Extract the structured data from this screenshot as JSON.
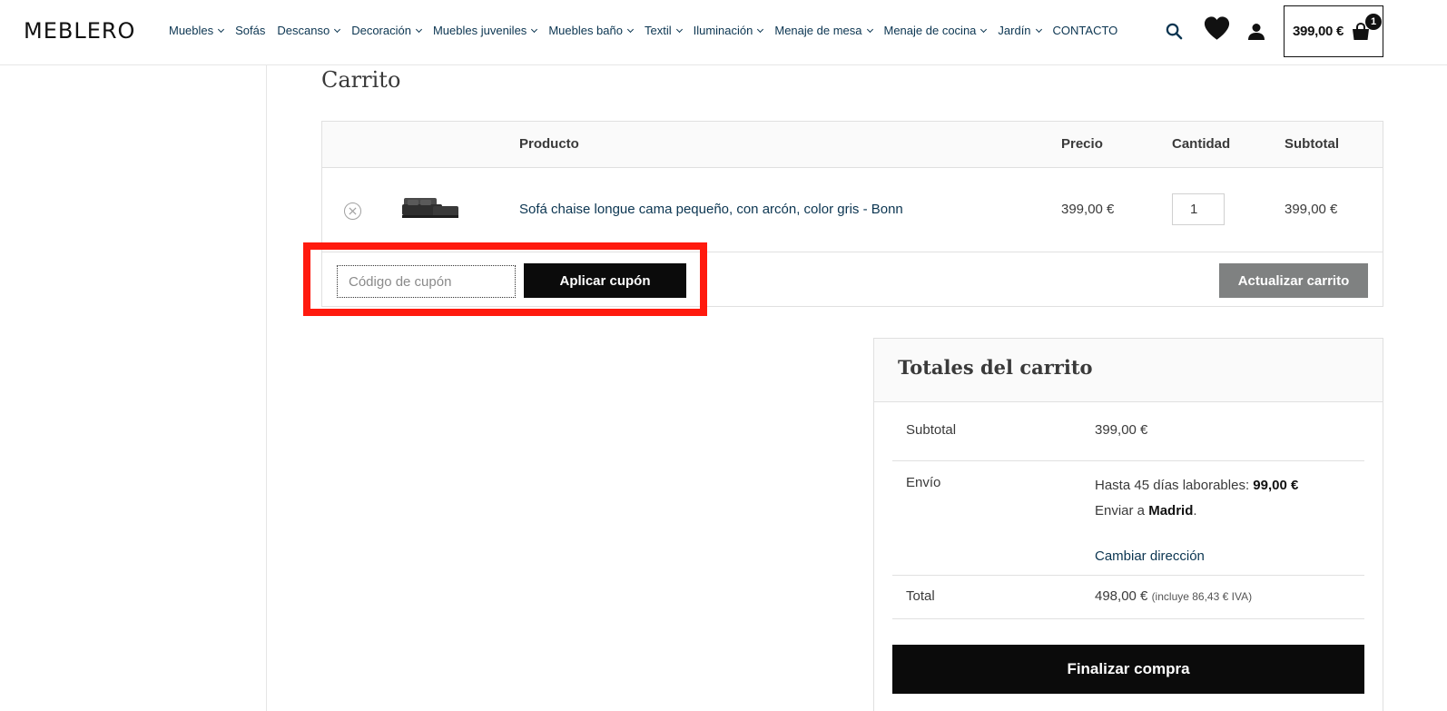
{
  "header": {
    "logo": "MEBLERO",
    "nav": [
      {
        "label": "Muebles",
        "has_dropdown": true
      },
      {
        "label": "Sofás",
        "has_dropdown": false
      },
      {
        "label": "Descanso",
        "has_dropdown": true
      },
      {
        "label": "Decoración",
        "has_dropdown": true
      },
      {
        "label": "Muebles juveniles",
        "has_dropdown": true
      },
      {
        "label": "Muebles baño",
        "has_dropdown": true
      },
      {
        "label": "Textil",
        "has_dropdown": true
      },
      {
        "label": "Iluminación",
        "has_dropdown": true
      },
      {
        "label": "Menaje de mesa",
        "has_dropdown": true
      },
      {
        "label": "Menaje de cocina",
        "has_dropdown": true
      },
      {
        "label": "Jardín",
        "has_dropdown": true
      },
      {
        "label": "CONTACTO",
        "has_dropdown": false
      }
    ],
    "icons": {
      "search": "search-icon",
      "wishlist": "heart-icon",
      "account": "user-icon",
      "cart": "shopping-bag-icon"
    },
    "cart_total": "399,00 €",
    "cart_count": "1"
  },
  "page": {
    "title": "Carrito"
  },
  "cart_table": {
    "headers": {
      "product": "Producto",
      "price": "Precio",
      "quantity": "Cantidad",
      "subtotal": "Subtotal"
    },
    "items": [
      {
        "name": "Sofá chaise longue cama pequeño, con arcón, color gris - Bonn",
        "price": "399,00 €",
        "quantity": "1",
        "subtotal": "399,00 €",
        "remove_icon": "close-circle-icon"
      }
    ]
  },
  "coupon": {
    "placeholder": "Código de cupón",
    "apply_label": "Aplicar cupón",
    "update_label": "Actualizar carrito"
  },
  "totals": {
    "title": "Totales del carrito",
    "subtotal_label": "Subtotal",
    "subtotal_value": "399,00 €",
    "shipping_label": "Envío",
    "shipping_method": "Hasta 45 días laborables:",
    "shipping_cost": "99,00 €",
    "ship_to_prefix": "Enviar a",
    "ship_to_city": "Madrid",
    "change_address": "Cambiar dirección",
    "total_label": "Total",
    "total_value": "498,00 €",
    "tax_note": "(incluye 86,43 € IVA)",
    "checkout_label": "Finalizar compra"
  },
  "colors": {
    "link": "#0b3551",
    "primary_button": "#0b0b0b",
    "secondary_button": "#7f8181",
    "highlight": "#ff1a0e"
  }
}
